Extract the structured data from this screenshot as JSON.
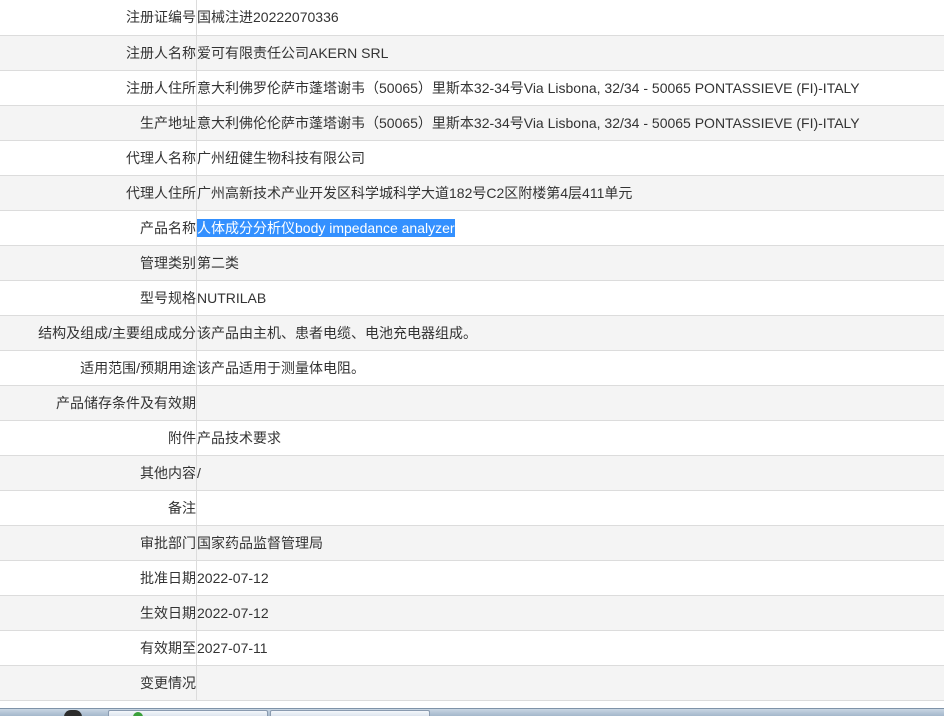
{
  "rows": [
    {
      "label": "注册证编号",
      "value": "国械注进20222070336"
    },
    {
      "label": "注册人名称",
      "value": "爱可有限责任公司AKERN SRL"
    },
    {
      "label": "注册人住所",
      "value": "意大利佛罗伦萨市蓬塔谢韦（50065）里斯本32-34号Via Lisbona, 32/34 - 50065 PONTASSIEVE (FI)-ITALY"
    },
    {
      "label": "生产地址",
      "value": "意大利佛伦伦萨市蓬塔谢韦（50065）里斯本32-34号Via Lisbona, 32/34 - 50065 PONTASSIEVE (FI)-ITALY"
    },
    {
      "label": "代理人名称",
      "value": "广州纽健生物科技有限公司"
    },
    {
      "label": "代理人住所",
      "value": "广州高新技术产业开发区科学城科学大道182号C2区附楼第4层411单元"
    },
    {
      "label": "产品名称",
      "value": "人体成分分析仪body impedance analyzer"
    },
    {
      "label": "管理类别",
      "value": "第二类"
    },
    {
      "label": "型号规格",
      "value": "NUTRILAB"
    },
    {
      "label": "结构及组成/主要组成成分",
      "value": "该产品由主机、患者电缆、电池充电器组成。"
    },
    {
      "label": "适用范围/预期用途",
      "value": "该产品适用于测量体电阻。"
    },
    {
      "label": "产品储存条件及有效期",
      "value": ""
    },
    {
      "label": "附件",
      "value": "产品技术要求"
    },
    {
      "label": "其他内容",
      "value": "/"
    },
    {
      "label": "备注",
      "value": ""
    },
    {
      "label": "审批部门",
      "value": "国家药品监督管理局"
    },
    {
      "label": "批准日期",
      "value": "2022-07-12"
    },
    {
      "label": "生效日期",
      "value": "2022-07-12"
    },
    {
      "label": "有效期至",
      "value": "2027-07-11"
    },
    {
      "label": "变更情况",
      "value": ""
    }
  ],
  "colors": {
    "selection": "#3390ff",
    "row_alt": "#f4f4f4",
    "border": "#dcdcdc",
    "text": "#333333"
  }
}
